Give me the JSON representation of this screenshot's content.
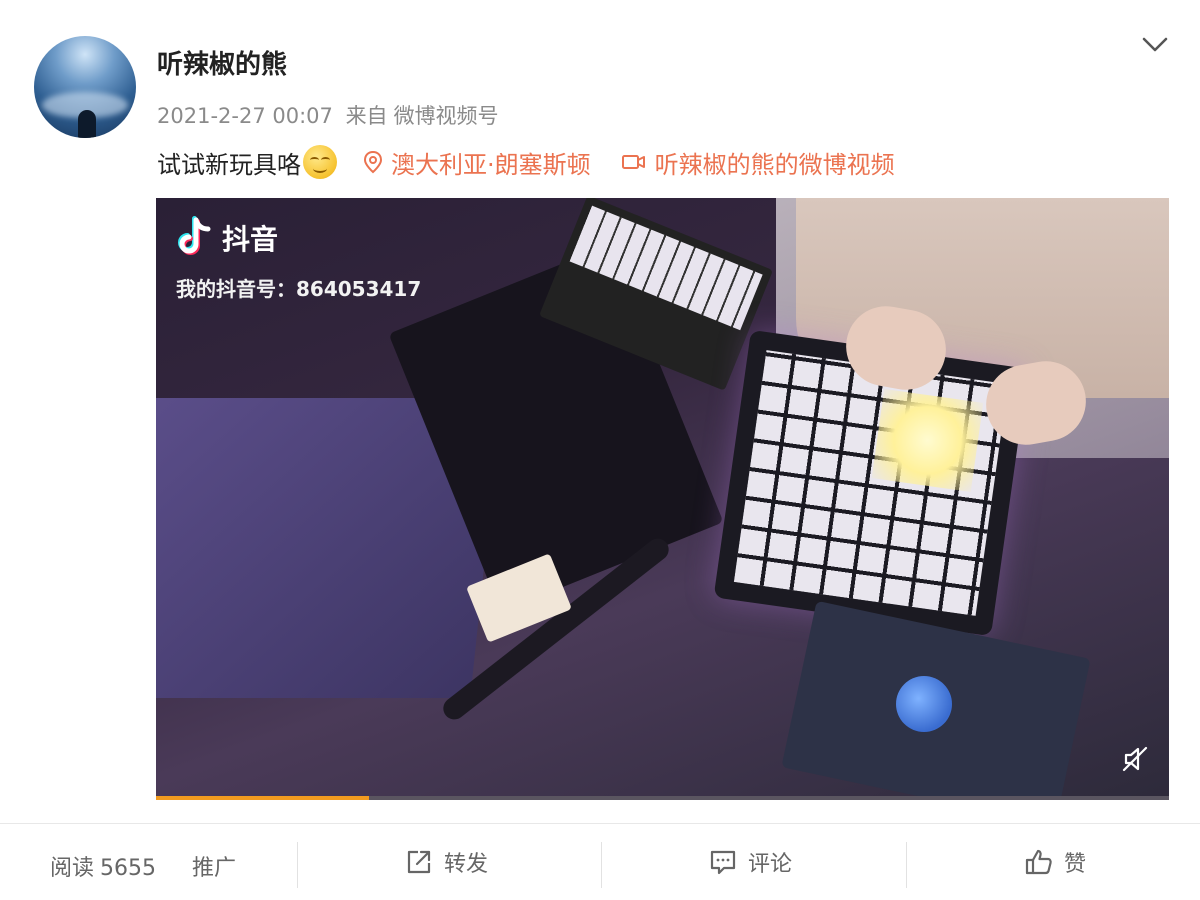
{
  "user": {
    "name": "听辣椒的熊"
  },
  "meta": {
    "time": "2021-2-27 00:07",
    "from_prefix": "来自",
    "source": "微博视频号"
  },
  "post": {
    "text": "试试新玩具咯",
    "location": "澳大利亚·朗塞斯顿",
    "video_link": "听辣椒的熊的微博视频"
  },
  "video": {
    "watermark_app": "抖音",
    "watermark_id": "我的抖音号：864053417",
    "progress": 0.21
  },
  "footer": {
    "read_label": "阅读",
    "read_count": "5655",
    "promote": "推广",
    "repost": "转发",
    "comment": "评论",
    "like": "赞"
  },
  "colors": {
    "link": "#eb7350",
    "progress": "#f29b1f"
  },
  "icons": [
    "chevron-down-icon",
    "location-pin-icon",
    "video-camera-icon",
    "tiktok-logo-icon",
    "mute-icon",
    "repost-icon",
    "comment-icon",
    "like-icon",
    "smile-emoji-icon"
  ]
}
